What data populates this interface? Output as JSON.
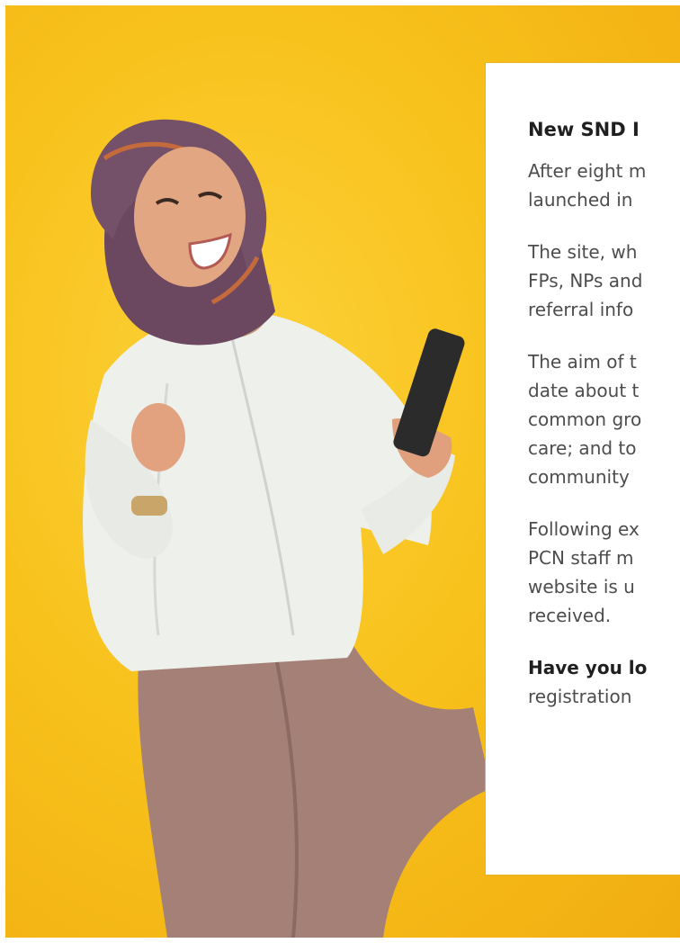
{
  "article": {
    "title": "New SND I",
    "paragraphs": [
      [
        "After eight m",
        "launched in"
      ],
      [
        "The site, wh",
        "FPs, NPs and",
        "referral info"
      ],
      [
        "The aim of t",
        "date about t",
        "common gro",
        "care; and to",
        "community"
      ],
      [
        "Following ex",
        "PCN staff m",
        "website is u",
        "received."
      ]
    ],
    "cta_bold": "Have you lo",
    "cta_rest": "registration"
  },
  "colors": {
    "background": "#f8c21c",
    "card_border": "#e9b51f",
    "text": "#4d4d4d",
    "heading": "#1f1f1f"
  }
}
